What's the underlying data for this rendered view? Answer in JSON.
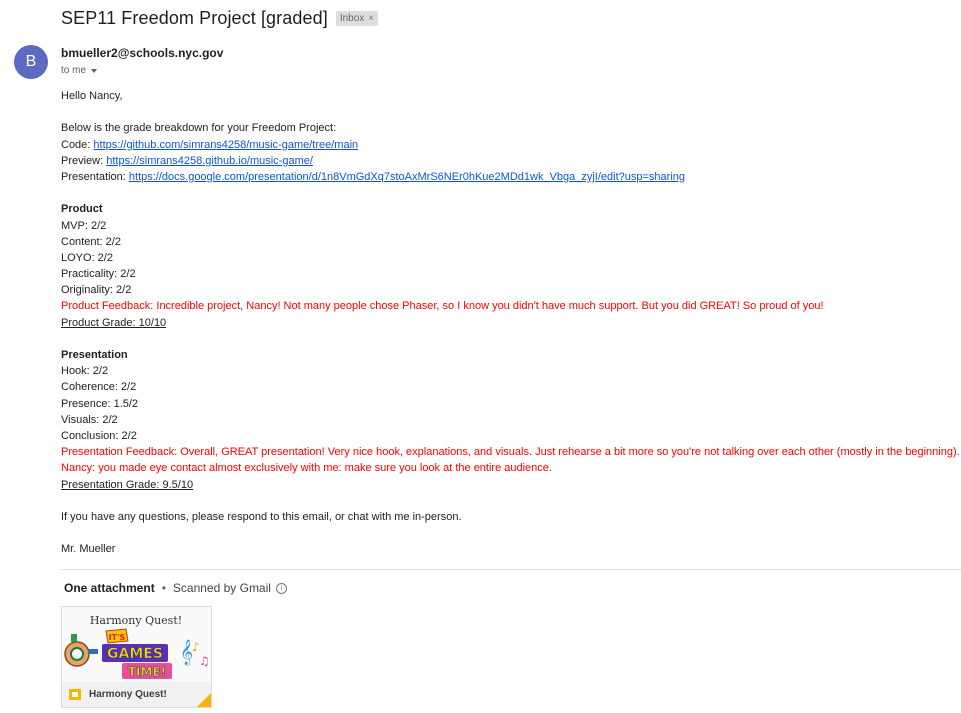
{
  "email": {
    "subject": "SEP11 Freedom Project [graded]",
    "label": "Inbox",
    "label_close": "×",
    "sender": {
      "initial": "B",
      "address": "bmueller2@schools.nyc.gov",
      "recipient": "to me",
      "avatar_color": "#5c6bc0"
    },
    "greeting": "Hello Nancy,",
    "intro": "Below is the grade breakdown for your Freedom Project:",
    "links": [
      {
        "label": "Code:",
        "url": "https://github.com/simrans4258/music-game/tree/main"
      },
      {
        "label": "Preview:",
        "url": "https://simrans4258.github.io/music-game/"
      },
      {
        "label": "Presentation:",
        "url": "https://docs.google.com/presentation/d/1n8VmGdXq7stoAxMrS6NEr0hKue2MDd1wk_Vbga_zyjI/edit?usp=sharing"
      }
    ],
    "product": {
      "heading": "Product",
      "items": [
        "MVP: 2/2",
        "Content: 2/2",
        "LOYO: 2/2",
        "Practicality: 2/2",
        "Originality: 2/2"
      ],
      "feedback": "Product Feedback: Incredible project, Nancy! Not many people chose Phaser, so I know you didn't have much support. But you did GREAT! So proud of you!",
      "grade": "Product Grade: 10/10"
    },
    "presentation": {
      "heading": "Presentation",
      "items": [
        "Hook: 2/2",
        "Coherence: 2/2",
        "Presence: 1.5/2",
        "Visuals: 2/2",
        "Conclusion: 2/2"
      ],
      "feedback_line1": "Presentation Feedback: Overall, GREAT presentation! Very nice hook, explanations, and visuals. Just rehearse a bit more so you're not talking over each other (mostly in the beginning).",
      "feedback_line2": "Nancy: you made eye contact almost exclusively with me: make sure you look at the entire audience.",
      "grade": "Presentation Grade: 9.5/10"
    },
    "closing": "If you have any questions, please respond to this email, or chat with me in-person.",
    "signature": "Mr. Mueller",
    "feedback_color": "#ff0000",
    "link_color": "#1155cc"
  },
  "attachments": {
    "heading": "One attachment",
    "scan_note": "Scanned by Gmail",
    "info_icon": "info-icon",
    "file": {
      "name": "Harmony Quest!",
      "thumb_title": "Harmony Quest!",
      "thumb_banner_line1": "IT'S",
      "thumb_banner_line2": "GAMES",
      "thumb_banner_line3": "TIME!",
      "icon": "slides-icon"
    }
  }
}
